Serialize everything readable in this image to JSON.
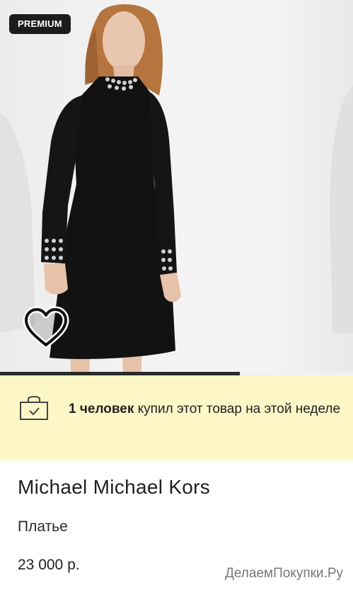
{
  "badge": {
    "label": "PREMIUM"
  },
  "gallery": {
    "progress_fraction": 0.68
  },
  "promo": {
    "bold": "1 человек",
    "text": " купил этот товар на этой неделе"
  },
  "product": {
    "brand": "Michael Michael Kors",
    "category": "Платье",
    "price": "23 000 р."
  },
  "watermark": "ДелаемПокупки.Ру",
  "icons": {
    "wishlist": "heart-icon",
    "promo": "shopping-bag-check-icon"
  },
  "colors": {
    "badge_bg": "#1c1c1c",
    "promo_bg": "#fdf7c7",
    "progress": "#2b2b2b"
  }
}
